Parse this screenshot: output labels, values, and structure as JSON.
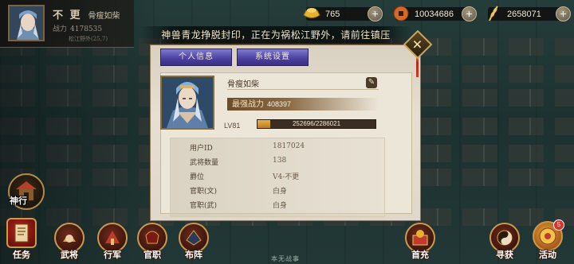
{
  "player": {
    "rank": "不 更",
    "name": "骨瘦如柴",
    "power_label": "战力",
    "power": "4178535",
    "location": "松江野外(25,7)"
  },
  "currencies": [
    {
      "name": "gold-ingot",
      "value": "765",
      "color": "#e6b12e"
    },
    {
      "name": "copper-coin",
      "value": "10034686",
      "color": "#d46a2a"
    },
    {
      "name": "grain",
      "value": "2658071",
      "color": "#e8c25a"
    }
  ],
  "quest_banner": "神兽青龙挣脱封印，正在为祸松江野外，请前往镇压",
  "dialog": {
    "tabs": [
      "个人信息",
      "系统设置"
    ],
    "close_glyph": "✕",
    "name": "骨瘦如柴",
    "power_label": "最强战力",
    "power_value": "408397",
    "level": "LV81",
    "exp_text": "252696/2286021",
    "exp_fraction": 0.1105,
    "info": [
      {
        "key": "用户ID",
        "value": "1817024"
      },
      {
        "key": "武将数量",
        "value": "138"
      },
      {
        "key": "爵位",
        "value": "V4-不更"
      },
      {
        "key": "官职(文)",
        "value": "白身"
      },
      {
        "key": "官职(武)",
        "value": "白身"
      }
    ]
  },
  "side": {
    "shrine_label": "神行"
  },
  "bottom_nav": [
    {
      "label": "任务",
      "icon": "scroll-icon"
    },
    {
      "label": "武将",
      "icon": "general-icon"
    },
    {
      "label": "行军",
      "icon": "march-icon"
    },
    {
      "label": "官职",
      "icon": "rank-icon"
    },
    {
      "label": "布阵",
      "icon": "formation-icon"
    },
    {
      "label": "首充",
      "icon": "first-charge-icon"
    },
    {
      "label": "寻获",
      "icon": "search-treasure-icon"
    },
    {
      "label": "活动",
      "icon": "event-icon",
      "badge": "5"
    }
  ],
  "bottom_center": "本无战事"
}
